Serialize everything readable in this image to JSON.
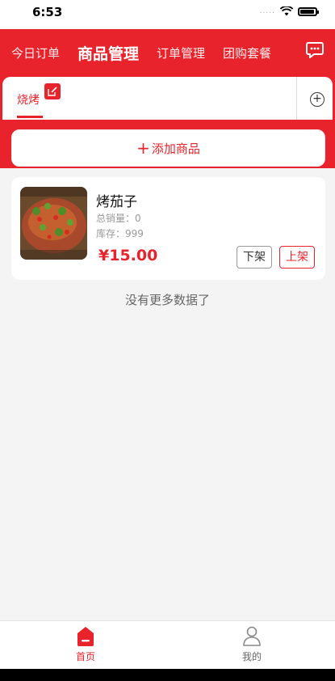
{
  "status": {
    "time": "6:53",
    "signal": "....."
  },
  "nav": {
    "items": [
      "今日订单",
      "商品管理",
      "订单管理",
      "团购套餐"
    ],
    "active_index": 1
  },
  "tabs": {
    "items": [
      "烧烤"
    ],
    "active": "烧烤"
  },
  "add_product_label": "添加商品",
  "add_product_plus": "+",
  "products": [
    {
      "name": "烤茄子",
      "sales_label": "总销量：",
      "sales": "0",
      "stock_label": "库存：",
      "stock": "999",
      "price": "¥15.00",
      "off_label": "下架",
      "on_label": "上架"
    }
  ],
  "no_more_text": "没有更多数据了",
  "bottom_nav": {
    "home": "首页",
    "me": "我的"
  },
  "colors": {
    "accent": "#e9232b",
    "background": "#f4f4f4"
  }
}
